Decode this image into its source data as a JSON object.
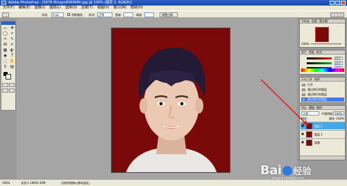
{
  "window": {
    "title": "Adobe Photoshop - [5878 f6mgm656946h.jpg @ 100% (图层 2, RGB/8)]"
  },
  "menu": {
    "items": [
      "文件(F)",
      "编辑(E)",
      "图像(I)",
      "图层(L)",
      "选择(S)",
      "滤镜(T)",
      "视图(V)",
      "窗口(W)",
      "帮助(H)"
    ]
  },
  "options": {
    "feather_label": "羽化:",
    "feather_value": "0 px",
    "antialias_label": "消除锯齿",
    "style_label": "样式:",
    "style_value": "正常",
    "width_label": "宽度:",
    "height_label": "高度:",
    "refine_btn": "调整边缘..."
  },
  "toolbox": {
    "tools": [
      "▭",
      "✥",
      "◯",
      "⌖",
      "✂",
      "✎",
      "⌘",
      "✐",
      "▦",
      "◐",
      "◆",
      "T",
      "⬚",
      "✋",
      "⚲",
      "▤"
    ]
  },
  "navigator": {
    "tabs": [
      "导航器",
      "信息",
      "直方图"
    ],
    "zoom": "100%"
  },
  "color": {
    "tabs": [
      "颜色",
      "色板",
      "样式"
    ],
    "r": "210",
    "g": "210",
    "b": "210",
    "channel_colors": [
      "#e01818",
      "#18b018",
      "#1840e0"
    ]
  },
  "history": {
    "tabs": [
      "历史记录",
      "动作"
    ],
    "items": [
      "打开",
      "通过拷贝的图层",
      "通过拷贝的图层",
      "通过拷贝的图层"
    ],
    "selected_index": 3
  },
  "layers": {
    "tabs": [
      "图层",
      "通道",
      "路径"
    ],
    "blend_mode": "正常",
    "opacity_label": "不透明度:",
    "opacity_value": "100%",
    "lock_label": "锁定:",
    "fill_label": "填充: 100%",
    "items": [
      {
        "name": "图层 2",
        "selected": true
      },
      {
        "name": "图层 1",
        "selected": false
      },
      {
        "name": "背景",
        "selected": false
      }
    ]
  },
  "status": {
    "zoom": "100%",
    "doc": "文档:1.10M/3.30M",
    "message": "点按并拖移以移动选区。"
  },
  "watermark": {
    "logo": "Bai",
    "logo2": "经验",
    "url": "jingyan.baidu.com"
  },
  "accent_colors": {
    "photo_background": "#7a0a0a",
    "selection": "#44a7e8",
    "arrow": "#e02020"
  }
}
